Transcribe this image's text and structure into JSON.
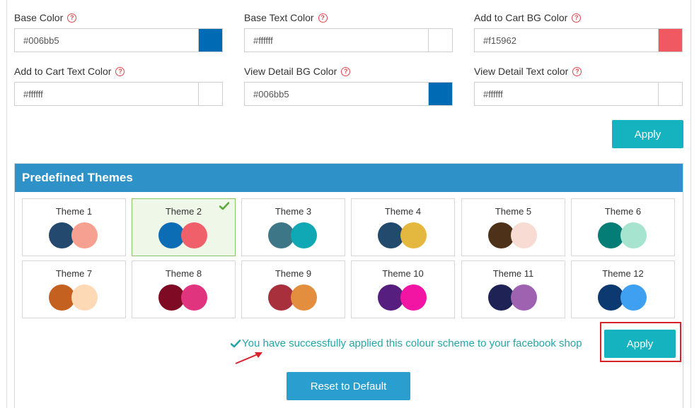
{
  "color_settings": {
    "fields": [
      {
        "label": "Base Color",
        "value": "#006bb5",
        "swatch": "#006bb5"
      },
      {
        "label": "Base Text Color",
        "value": "#ffffff",
        "swatch": "#ffffff"
      },
      {
        "label": "Add to Cart BG Color",
        "value": "#f15962",
        "swatch": "#f15962"
      },
      {
        "label": "Add to Cart Text Color",
        "value": "#ffffff",
        "swatch": "#ffffff"
      },
      {
        "label": "View Detail BG Color",
        "value": "#006bb5",
        "swatch": "#006bb5"
      },
      {
        "label": "View Detail Text color",
        "value": "#ffffff",
        "swatch": "#ffffff"
      }
    ],
    "help_icon_glyph": "?",
    "apply_label": "Apply"
  },
  "themes": {
    "title": "Predefined Themes",
    "selected_index": 1,
    "items": [
      {
        "name": "Theme 1",
        "colors": [
          "#234a6e",
          "#f5a090"
        ]
      },
      {
        "name": "Theme 2",
        "colors": [
          "#0c6db4",
          "#f0606a"
        ]
      },
      {
        "name": "Theme 3",
        "colors": [
          "#3c7687",
          "#11a8b6"
        ]
      },
      {
        "name": "Theme 4",
        "colors": [
          "#224a6c",
          "#e4b83f"
        ]
      },
      {
        "name": "Theme 5",
        "colors": [
          "#4e3119",
          "#f8dbd3"
        ]
      },
      {
        "name": "Theme 6",
        "colors": [
          "#047d76",
          "#a7e4d0"
        ]
      },
      {
        "name": "Theme 7",
        "colors": [
          "#c46120",
          "#fdd9b6"
        ]
      },
      {
        "name": "Theme 8",
        "colors": [
          "#7e0a24",
          "#e0347e"
        ]
      },
      {
        "name": "Theme 9",
        "colors": [
          "#a82f3c",
          "#e28e3e"
        ]
      },
      {
        "name": "Theme 10",
        "colors": [
          "#561e7e",
          "#f214a2"
        ]
      },
      {
        "name": "Theme 11",
        "colors": [
          "#1e2255",
          "#9f62b1"
        ]
      },
      {
        "name": "Theme 12",
        "colors": [
          "#0c3a70",
          "#3fa0f2"
        ]
      }
    ],
    "success_message": "You have successfully applied this colour scheme to your facebook shop",
    "apply_label": "Apply",
    "reset_label": "Reset to Default"
  },
  "colors": {
    "accent_teal": "#15b3c0",
    "header_blue": "#2e91c8",
    "reset_blue": "#2a9fcf",
    "success_text": "#25a5a8",
    "highlight_red": "#d9232a",
    "help_red": "#e0474c"
  }
}
